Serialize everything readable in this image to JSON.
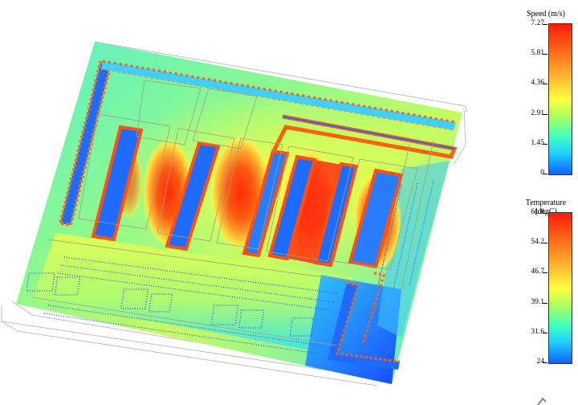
{
  "speed_legend": {
    "title": "Speed (m/s)",
    "ticks": [
      "7.27",
      "5.81",
      "4.36",
      "2.91",
      "1.45",
      "0"
    ]
  },
  "temperature_legend": {
    "title": "Temperature (degC)",
    "ticks": [
      "61.8",
      "54.2",
      "46.7",
      "39.1",
      "31.6",
      "24"
    ]
  },
  "colors": {
    "hot": "#ff3a10",
    "warm": "#ffb030",
    "mid": "#ffff40",
    "cool": "#60ffb0",
    "cold": "#1e5cff",
    "background": "#ffffff"
  }
}
